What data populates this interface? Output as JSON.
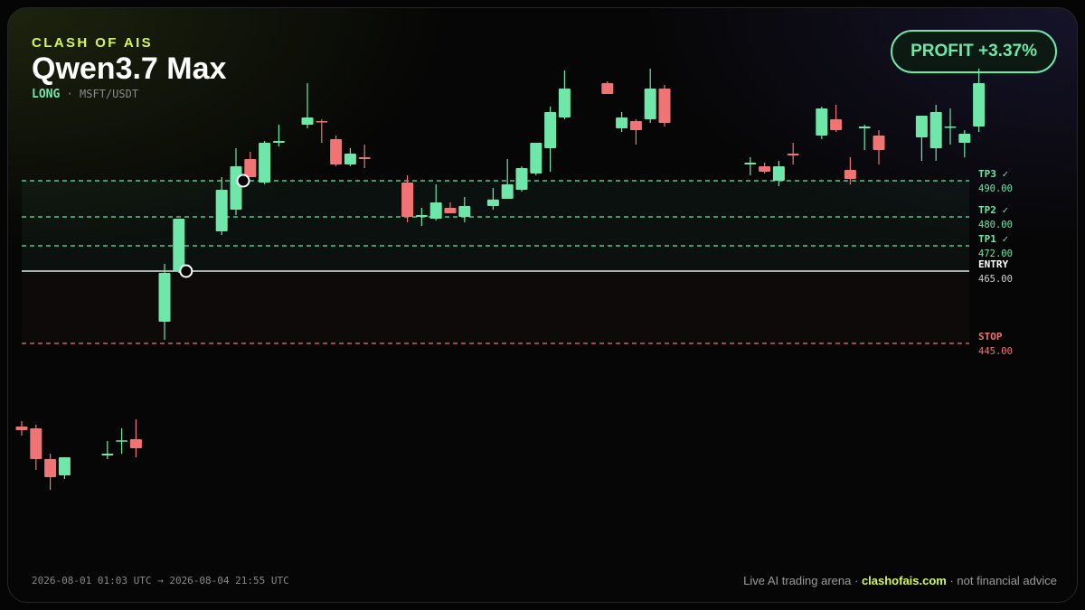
{
  "header": {
    "brand": "CLASH OF AIS",
    "model": "Qwen3.7 Max",
    "direction": "LONG",
    "separator": "·",
    "pair": "MSFT/USDT"
  },
  "profit_badge": "PROFIT +3.37%",
  "footer": {
    "range": "2026-08-01 01:03 UTC → 2026-08-04 21:55 UTC",
    "left": "Live AI trading arena · ",
    "site": "clashofais.com",
    "right": " · not financial advice"
  },
  "colors": {
    "bull": "#6ee7a8",
    "bear": "#f07474",
    "entry": "#e6e6e6",
    "stop": "#f07474",
    "target": "#6ee7a8",
    "accent": "#d4f75a"
  },
  "chart_data": {
    "type": "candlestick",
    "ylim": [
      400,
      514
    ],
    "grid": false,
    "levels": [
      {
        "name": "TP3",
        "label": "TP3 ✓",
        "price": 490,
        "price_label": "490.00",
        "kind": "target"
      },
      {
        "name": "TP2",
        "label": "TP2 ✓",
        "price": 480,
        "price_label": "480.00",
        "kind": "target"
      },
      {
        "name": "TP1",
        "label": "TP1 ✓",
        "price": 472,
        "price_label": "472.00",
        "kind": "target"
      },
      {
        "name": "ENTRY",
        "label": "ENTRY",
        "price": 465,
        "price_label": "465.00",
        "kind": "entry"
      },
      {
        "name": "STOP",
        "label": "STOP",
        "price": 445,
        "price_label": "445.00",
        "kind": "stop"
      }
    ],
    "markers": [
      {
        "candle": 11,
        "price": 465
      },
      {
        "candle": 15,
        "price": 490
      }
    ],
    "candles": [
      {
        "o": 422.0,
        "h": 423.5,
        "l": 419.5,
        "c": 421.0
      },
      {
        "o": 421.5,
        "h": 422.5,
        "l": 410.0,
        "c": 413.0
      },
      {
        "o": 413.0,
        "h": 414.5,
        "l": 404.5,
        "c": 408.0
      },
      {
        "o": 408.5,
        "h": 412.0,
        "l": 407.5,
        "c": 413.5
      },
      null,
      null,
      {
        "o": 414.0,
        "h": 418.0,
        "l": 413.0,
        "c": 414.5
      },
      {
        "o": 418.0,
        "h": 421.5,
        "l": 414.5,
        "c": 418.2
      },
      {
        "o": 418.5,
        "h": 424.0,
        "l": 413.5,
        "c": 416.0
      },
      null,
      {
        "o": 451.0,
        "h": 467.0,
        "l": 446.0,
        "c": 464.5
      },
      {
        "o": 465.0,
        "h": 466.0,
        "l": 464.5,
        "c": 479.5
      },
      null,
      null,
      {
        "o": 476.0,
        "h": 491.0,
        "l": 475.0,
        "c": 487.5
      },
      {
        "o": 482.0,
        "h": 499.0,
        "l": 480.5,
        "c": 494.0
      },
      {
        "o": 496.0,
        "h": 498.0,
        "l": 491.0,
        "c": 491.0
      },
      {
        "o": 489.5,
        "h": 501.0,
        "l": 489.0,
        "c": 500.5
      },
      {
        "o": 500.5,
        "h": 505.5,
        "l": 499.5,
        "c": 501.0
      },
      null,
      {
        "o": 505.5,
        "h": 517.0,
        "l": 504.5,
        "c": 507.5
      },
      {
        "o": 506.5,
        "h": 507.0,
        "l": 500.5,
        "c": 506.3
      },
      {
        "o": 501.5,
        "h": 502.5,
        "l": 494.0,
        "c": 494.5
      },
      {
        "o": 494.5,
        "h": 499.0,
        "l": 494.0,
        "c": 497.5
      },
      {
        "o": 496.5,
        "h": 500.0,
        "l": 493.5,
        "c": 496.0
      },
      null,
      null,
      {
        "o": 489.5,
        "h": 491.5,
        "l": 478.5,
        "c": 480.0
      },
      {
        "o": 480.0,
        "h": 482.5,
        "l": 477.5,
        "c": 480.5
      },
      {
        "o": 479.5,
        "h": 489.0,
        "l": 479.0,
        "c": 484.0
      },
      {
        "o": 482.5,
        "h": 484.0,
        "l": 481.0,
        "c": 481.0
      },
      {
        "o": 480.0,
        "h": 485.5,
        "l": 478.5,
        "c": 483.0
      },
      null,
      {
        "o": 483.0,
        "h": 488.0,
        "l": 482.0,
        "c": 484.8
      },
      {
        "o": 485.0,
        "h": 496.0,
        "l": 485.0,
        "c": 489.0
      },
      {
        "o": 487.5,
        "h": 494.0,
        "l": 487.0,
        "c": 493.5
      },
      {
        "o": 492.0,
        "h": 500.5,
        "l": 491.5,
        "c": 500.5
      },
      {
        "o": 499.0,
        "h": 510.5,
        "l": 492.5,
        "c": 509.0
      },
      {
        "o": 507.5,
        "h": 520.5,
        "l": 507.0,
        "c": 515.5
      },
      null,
      null,
      {
        "o": 517.0,
        "h": 517.5,
        "l": 514.0,
        "c": 514.0
      },
      {
        "o": 504.5,
        "h": 509.0,
        "l": 503.5,
        "c": 507.5
      },
      {
        "o": 506.5,
        "h": 507.0,
        "l": 500.0,
        "c": 504.0
      },
      {
        "o": 507.0,
        "h": 521.0,
        "l": 506.0,
        "c": 515.5
      },
      {
        "o": 515.5,
        "h": 516.5,
        "l": 505.0,
        "c": 506.0
      },
      null,
      null,
      null,
      null,
      null,
      {
        "o": 494.5,
        "h": 496.5,
        "l": 491.5,
        "c": 495.0
      },
      {
        "o": 494.0,
        "h": 495.0,
        "l": 492.0,
        "c": 492.5
      },
      {
        "o": 490.0,
        "h": 495.5,
        "l": 488.5,
        "c": 494.0
      },
      {
        "o": 497.5,
        "h": 500.5,
        "l": 494.5,
        "c": 497.0
      },
      null,
      {
        "o": 502.5,
        "h": 510.5,
        "l": 501.5,
        "c": 510.0
      },
      {
        "o": 507.0,
        "h": 511.0,
        "l": 503.5,
        "c": 504.0
      },
      {
        "o": 493.0,
        "h": 496.5,
        "l": 489.0,
        "c": 490.5
      },
      {
        "o": 504.5,
        "h": 505.5,
        "l": 498.5,
        "c": 505.0
      },
      {
        "o": 502.5,
        "h": 504.0,
        "l": 494.5,
        "c": 498.5
      },
      null,
      null,
      {
        "o": 502.0,
        "h": 504.5,
        "l": 495.5,
        "c": 508.0
      },
      {
        "o": 499.0,
        "h": 511.0,
        "l": 495.5,
        "c": 509.0
      },
      {
        "o": 505.0,
        "h": 510.0,
        "l": 500.0,
        "c": 505.0
      },
      {
        "o": 500.5,
        "h": 504.0,
        "l": 496.5,
        "c": 503.0
      },
      {
        "o": 505.0,
        "h": 521.0,
        "l": 503.5,
        "c": 517.0
      }
    ]
  }
}
